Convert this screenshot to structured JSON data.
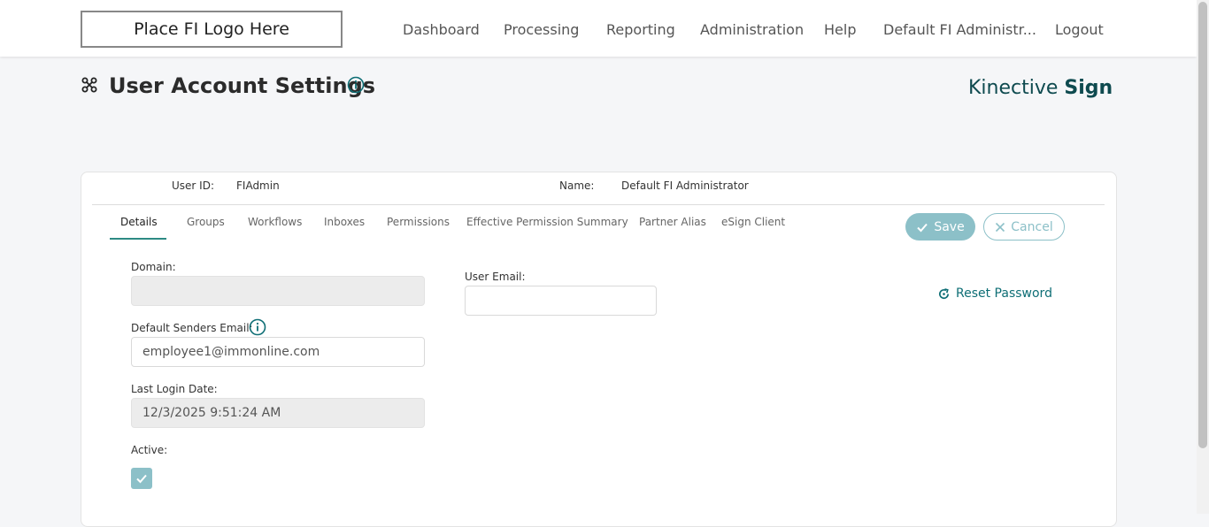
{
  "logo": {
    "text": "Place FI Logo Here"
  },
  "nav": {
    "items": [
      "Dashboard",
      "Processing",
      "Reporting",
      "Administration",
      "Help",
      "Default FI Administr...",
      "Logout"
    ]
  },
  "page": {
    "title": "User Account Settings",
    "brand_light": "Kinective ",
    "brand_bold": "Sign"
  },
  "user": {
    "id_label": "User ID:",
    "id_value": "FIAdmin",
    "name_label": "Name:",
    "name_value": "Default FI Administrator"
  },
  "tabs": [
    "Details",
    "Groups",
    "Workflows",
    "Inboxes",
    "Permissions",
    "Effective Permission Summary",
    "Partner Alias",
    "eSign Client"
  ],
  "active_tab": "Details",
  "actions": {
    "save_label": "Save",
    "cancel_label": "Cancel",
    "reset_password_label": "Reset Password"
  },
  "form": {
    "domain_label": "Domain:",
    "domain_value": "",
    "user_email_label": "User Email:",
    "user_email_value": "",
    "default_senders_email_label": "Default Senders Email:",
    "default_senders_email_value": "employee1@immonline.com",
    "last_login_label": "Last Login Date:",
    "last_login_value": "12/3/2025 9:51:24 AM",
    "active_label": "Active:",
    "active_checked": true
  },
  "colors": {
    "accent": "#2d8a84",
    "button": "#8cc0c8",
    "brand": "#0e4a4f",
    "link": "#0e6e75"
  },
  "icons": {
    "header": "command-icon",
    "info": "info-circle-icon",
    "save": "check-icon",
    "cancel": "close-icon",
    "reset": "refresh-icon",
    "checkbox": "check-icon"
  }
}
